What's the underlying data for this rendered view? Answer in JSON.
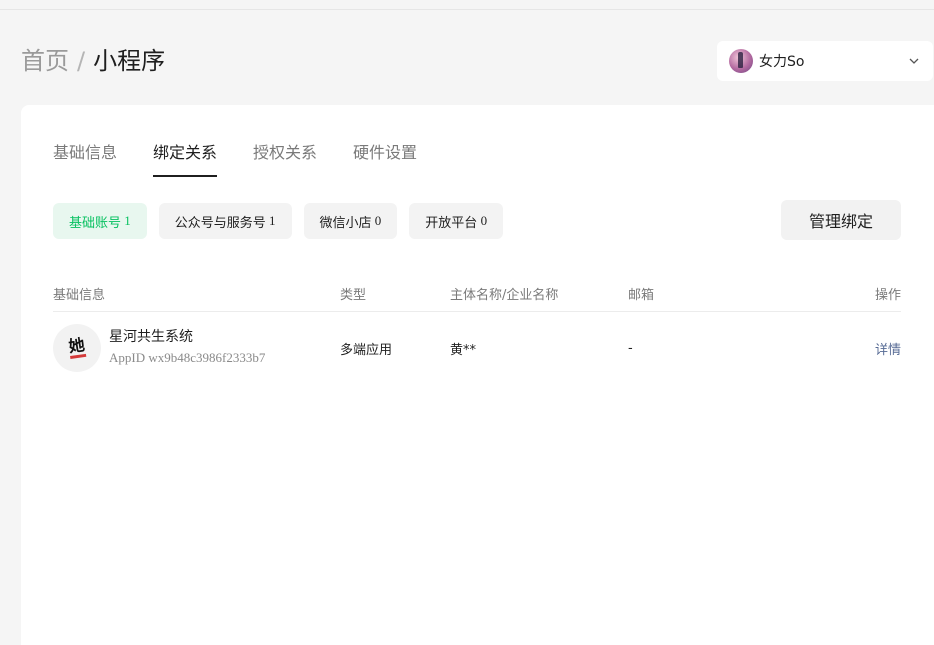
{
  "breadcrumb": {
    "home": "首页",
    "separator": "/",
    "current": "小程序"
  },
  "account": {
    "name": "女力So",
    "avatar_icon": "user-avatar",
    "dropdown_icon": "chevron-down-icon"
  },
  "tabs": [
    {
      "label": "基础信息",
      "active": false
    },
    {
      "label": "绑定关系",
      "active": true
    },
    {
      "label": "授权关系",
      "active": false
    },
    {
      "label": "硬件设置",
      "active": false
    }
  ],
  "chips": [
    {
      "label": "基础账号",
      "count": "1",
      "active": true
    },
    {
      "label": "公众号与服务号",
      "count": "1",
      "active": false
    },
    {
      "label": "微信小店",
      "count": "0",
      "active": false
    },
    {
      "label": "开放平台",
      "count": "0",
      "active": false
    }
  ],
  "manage_button": "管理绑定",
  "table": {
    "headers": [
      "基础信息",
      "类型",
      "主体名称/企业名称",
      "邮箱",
      "操作"
    ],
    "rows": [
      {
        "app_name": "星河共生系统",
        "app_id": "AppID wx9b48c3986f2333b7",
        "type": "多端应用",
        "subject": "黄**",
        "email": "-",
        "action": "详情",
        "logo_text": "她"
      }
    ]
  },
  "colors": {
    "accent_green": "#07c160",
    "link_blue": "#576b95",
    "background": "#f5f5f5"
  }
}
